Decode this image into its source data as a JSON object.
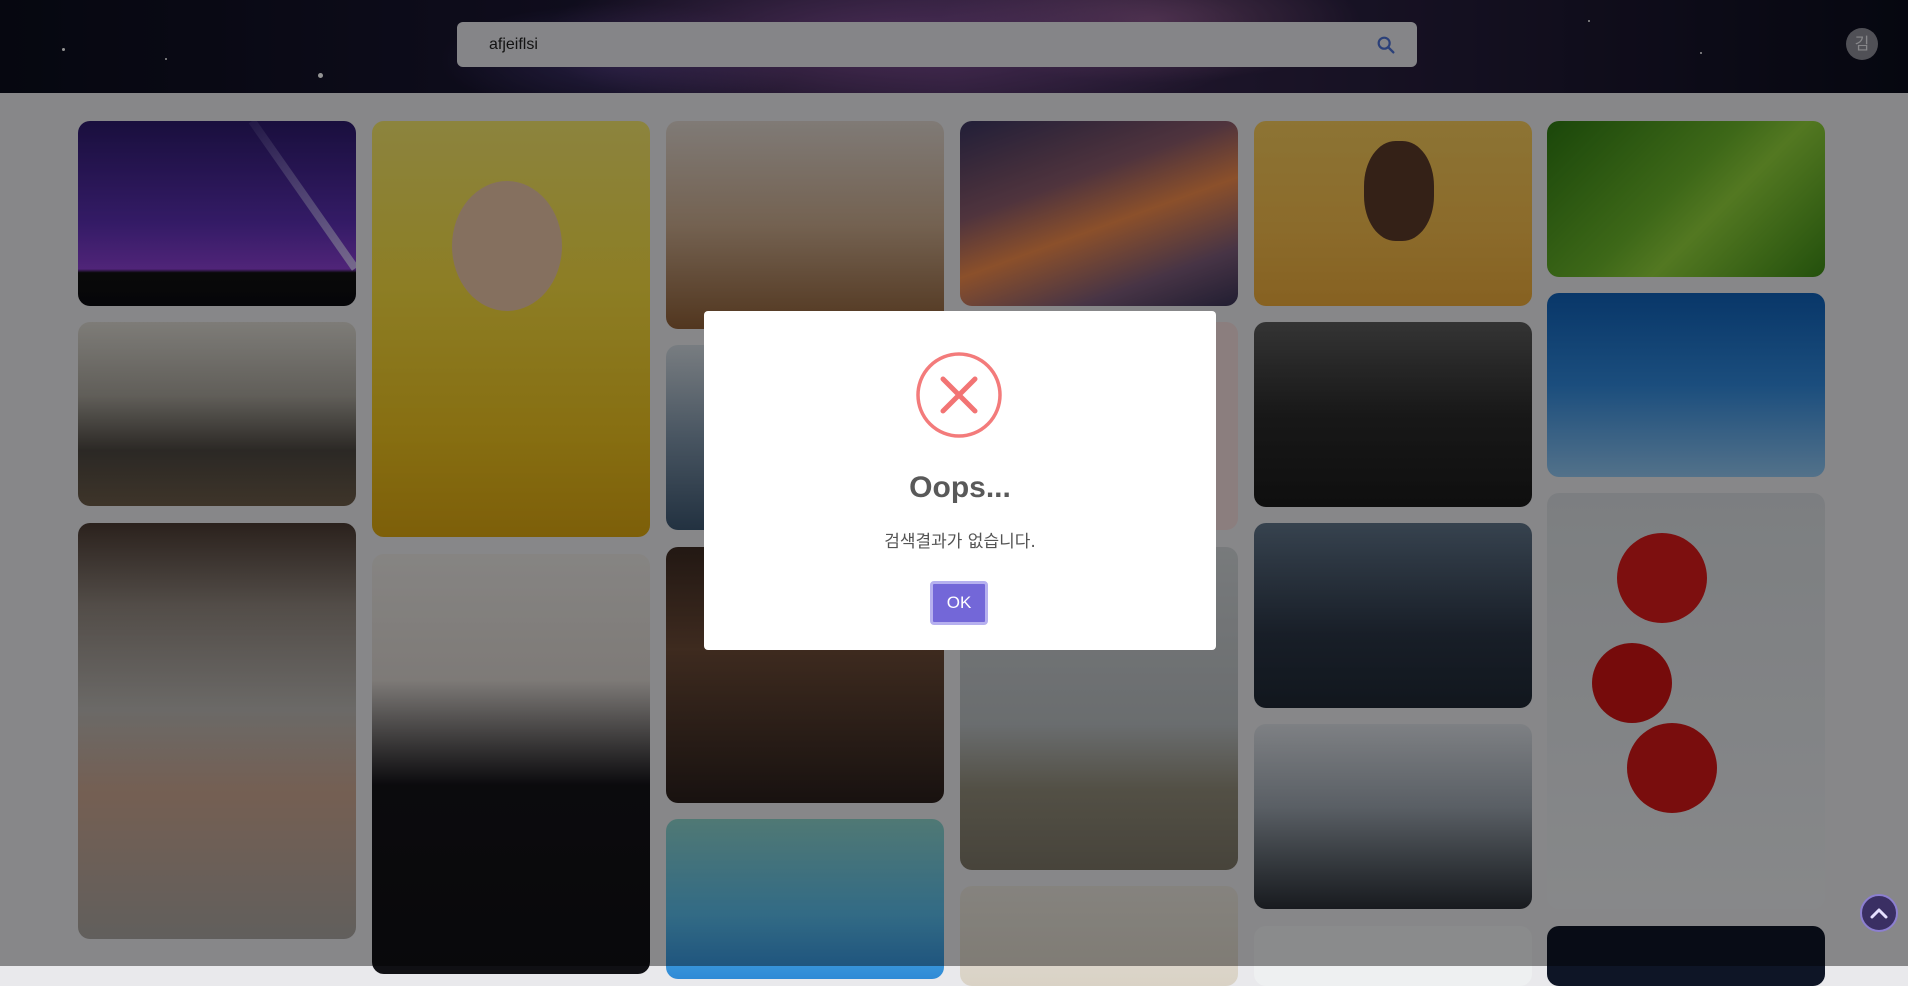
{
  "search": {
    "value": "afjeiflsi",
    "icon": "search-icon"
  },
  "user": {
    "avatar_initial": "김"
  },
  "colors": {
    "accent": "#7367d8",
    "error": "#f27474"
  },
  "gallery": {
    "images": [
      "night-sky-flashlight",
      "people-meeting-table",
      "hand-stop-gesture",
      "child-covering-eyes",
      "woman-pointing",
      "dried-flowers",
      "ocean-ice",
      "library-bookshelves",
      "piggy-bank-coin",
      "sunset-clouds",
      "pink-blur",
      "deer-tree-field",
      "office-shelves",
      "woman-makeup",
      "boxing-gym",
      "thumbs-up-suit",
      "city-view-hand",
      "fog-photo",
      "green-leaf-texture",
      "blue-sky",
      "red-heart-balloons",
      "dark-photo"
    ]
  },
  "dialog": {
    "icon": "error-x-icon",
    "title": "Oops...",
    "message": "검색결과가 없습니다.",
    "ok_label": "OK"
  },
  "scroll_top": {
    "icon": "arrow-up-icon"
  }
}
